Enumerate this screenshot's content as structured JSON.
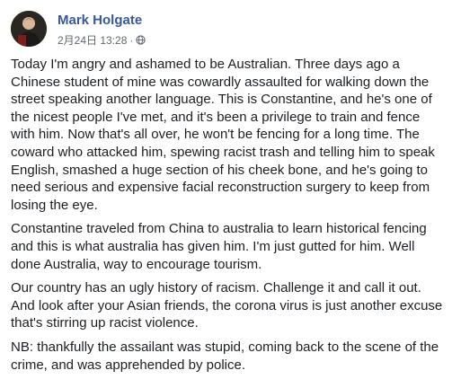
{
  "post": {
    "author": "Mark Holgate",
    "timestamp": "2月24日 13:28",
    "separator": "·",
    "privacy_icon": "globe-icon",
    "paragraphs": [
      "Today I'm angry and ashamed to be Australian. Three days ago a Chinese student of mine was cowardly assaulted for walking down the street speaking another language. This is Constantine, and he's one of the nicest people I've met, and it's been a privilege to train and fence with him. Now that's all over, he won't be fencing for a long time. The coward who attacked him, spewing racist trash and telling him to speak English, smashed a huge section of his cheek bone, and he's going to need serious and expensive facial reconstruction surgery to keep from losing the eye.",
      "Constantine traveled from China to australia to learn historical fencing and this is what australia has given him. I'm just gutted for him. Well done Australia, way to encourage tourism.",
      "Our country has an ugly history of racism. Challenge it and call it out. And look after your Asian friends, the corona virus is just another excuse that's stirring up racist violence.",
      "NB: thankfully the assailant was stupid, coming back to the scene of the crime, and was apprehended by police."
    ]
  },
  "colors": {
    "author_link": "#385898",
    "meta_text": "#606770",
    "body_text": "#1c1e21",
    "background": "#ffffff"
  }
}
